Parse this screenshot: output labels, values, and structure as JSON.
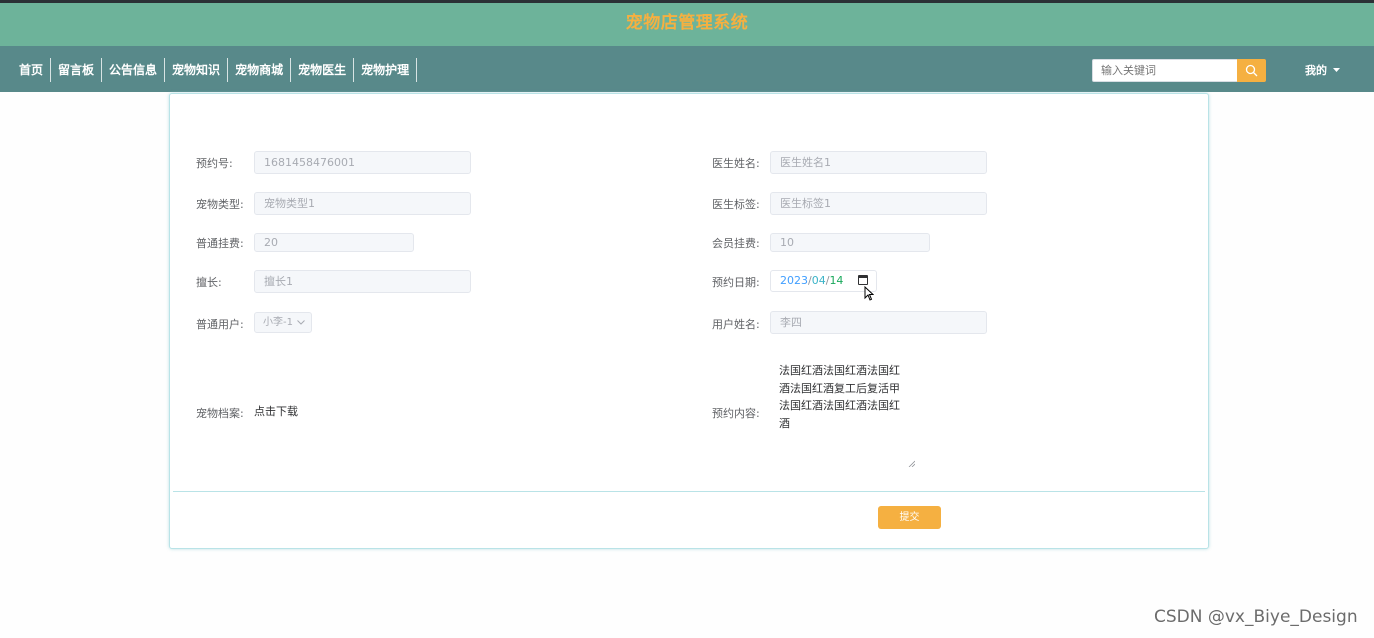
{
  "app": {
    "title": "宠物店管理系统"
  },
  "nav": {
    "items": [
      {
        "label": "首页"
      },
      {
        "label": "留言板"
      },
      {
        "label": "公告信息"
      },
      {
        "label": "宠物知识"
      },
      {
        "label": "宠物商城"
      },
      {
        "label": "宠物医生"
      },
      {
        "label": "宠物护理"
      }
    ],
    "search_placeholder": "输入关键词",
    "user_menu_label": "我的"
  },
  "form": {
    "booking_no": {
      "label": "预约号:",
      "value": "1681458476001"
    },
    "doctor_name": {
      "label": "医生姓名:",
      "value": "医生姓名1"
    },
    "pet_type": {
      "label": "宠物类型:",
      "value": "宠物类型1"
    },
    "doctor_tag": {
      "label": "医生标签:",
      "value": "医生标签1"
    },
    "normal_fee": {
      "label": "普通挂费:",
      "value": "20"
    },
    "member_fee": {
      "label": "会员挂费:",
      "value": "10"
    },
    "specialty": {
      "label": "擅长:",
      "value": "擅长1"
    },
    "booking_date": {
      "label": "预约日期:",
      "year": "2023",
      "month": "04",
      "day": "14",
      "separator": "/"
    },
    "normal_user": {
      "label": "普通用户:",
      "value": "小李-1"
    },
    "user_name": {
      "label": "用户姓名:",
      "value": "李四"
    },
    "pet_file": {
      "label": "宠物档案:",
      "link": "点击下载"
    },
    "booking_content": {
      "label": "预约内容:",
      "lines": [
        "法国红酒法国红酒法国红",
        "酒法国红酒复工后复活甲",
        "法国红酒法国红酒法国红",
        "酒"
      ]
    },
    "submit_label": "提交"
  },
  "watermark": "CSDN @vx_Biye_Design",
  "colors": {
    "header": "#6db39a",
    "nav": "#58898a",
    "accent": "#f5b041",
    "card_border": "#b9e3e7"
  }
}
